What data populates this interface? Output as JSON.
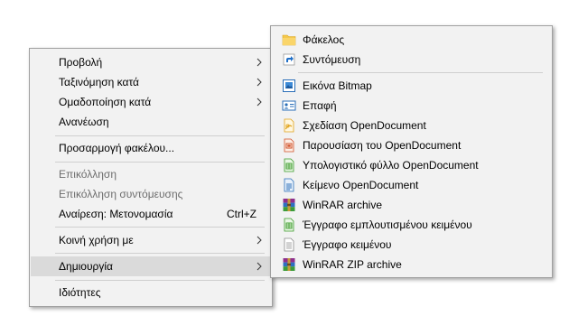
{
  "context_menu": {
    "view": "Προβολή",
    "sort_by": "Ταξινόμηση κατά",
    "group_by": "Ομαδοποίηση κατά",
    "refresh": "Ανανέωση",
    "customize_folder": "Προσαρμογή φακέλου...",
    "paste": "Επικόλληση",
    "paste_shortcut": "Επικόλληση συντόμευσης",
    "undo_rename": "Αναίρεση: Μετονομασία",
    "undo_shortcut": "Ctrl+Z",
    "share_with": "Κοινή χρήση με",
    "new": "Δημιουργία",
    "properties": "Ιδιότητες"
  },
  "submenu": {
    "folder": "Φάκελος",
    "shortcut": "Συντόμευση",
    "bitmap": "Εικόνα Bitmap",
    "contact": "Επαφή",
    "od_drawing": "Σχεδίαση OpenDocument",
    "od_presentation": "Παρουσίαση του OpenDocument",
    "od_spreadsheet": "Υπολογιστικό φύλλο OpenDocument",
    "od_text": "Κείμενο OpenDocument",
    "winrar": "WinRAR archive",
    "rtf": "Έγγραφο εμπλουτισμένου κειμένου",
    "txt": "Έγγραφο κειμένου",
    "winrar_zip": "WinRAR ZIP archive"
  },
  "colors": {
    "menu_bg": "#f2f2f2",
    "highlight": "#dadada",
    "disabled_text": "#6d6d6d"
  }
}
